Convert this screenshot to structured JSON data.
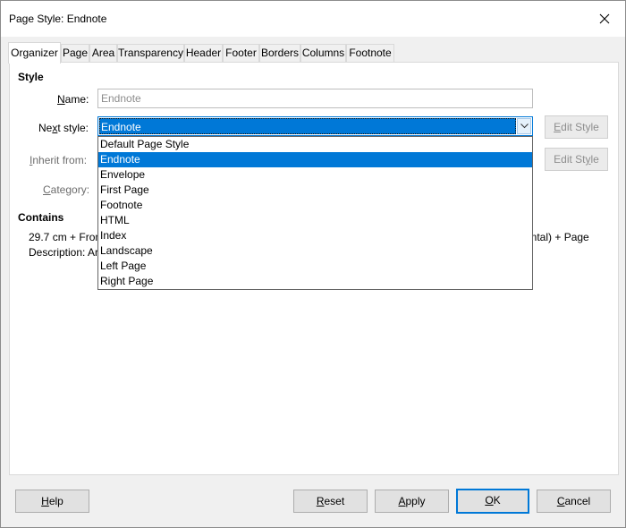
{
  "window": {
    "title": "Page Style: Endnote"
  },
  "tabs": [
    {
      "label": "Organizer",
      "active": true
    },
    {
      "label": "Page"
    },
    {
      "label": "Area"
    },
    {
      "label": "Transparency"
    },
    {
      "label": "Header"
    },
    {
      "label": "Footer"
    },
    {
      "label": "Borders"
    },
    {
      "label": "Columns"
    },
    {
      "label": "Footnote"
    }
  ],
  "style_section": {
    "heading": "Style",
    "name_label": "Name:",
    "name_value": "Endnote",
    "next_style_label": "Next style:",
    "next_style_value": "Endnote",
    "inherit_from_label": "Inherit from:",
    "category_label": "Category:",
    "edit_style_label": "Edit Style"
  },
  "dropdown": {
    "options": [
      {
        "label": "Default Page Style"
      },
      {
        "label": "Endnote",
        "selected": true
      },
      {
        "label": "Envelope"
      },
      {
        "label": "First Page"
      },
      {
        "label": "Footnote"
      },
      {
        "label": "HTML"
      },
      {
        "label": "Index"
      },
      {
        "label": "Landscape"
      },
      {
        "label": "Left Page"
      },
      {
        "label": "Right Page"
      }
    ]
  },
  "contains_section": {
    "heading": "Contains",
    "line1_left": "29.7 cm + From",
    "line1_right": "zontal) + Page",
    "line2_left": "Description: Ar"
  },
  "buttons": {
    "help": "Help",
    "reset": "Reset",
    "apply": "Apply",
    "ok": "OK",
    "cancel": "Cancel"
  },
  "colors": {
    "accent": "#0078d7",
    "dialog_bg": "#f0f0f0",
    "panel_bg": "#ffffff"
  }
}
